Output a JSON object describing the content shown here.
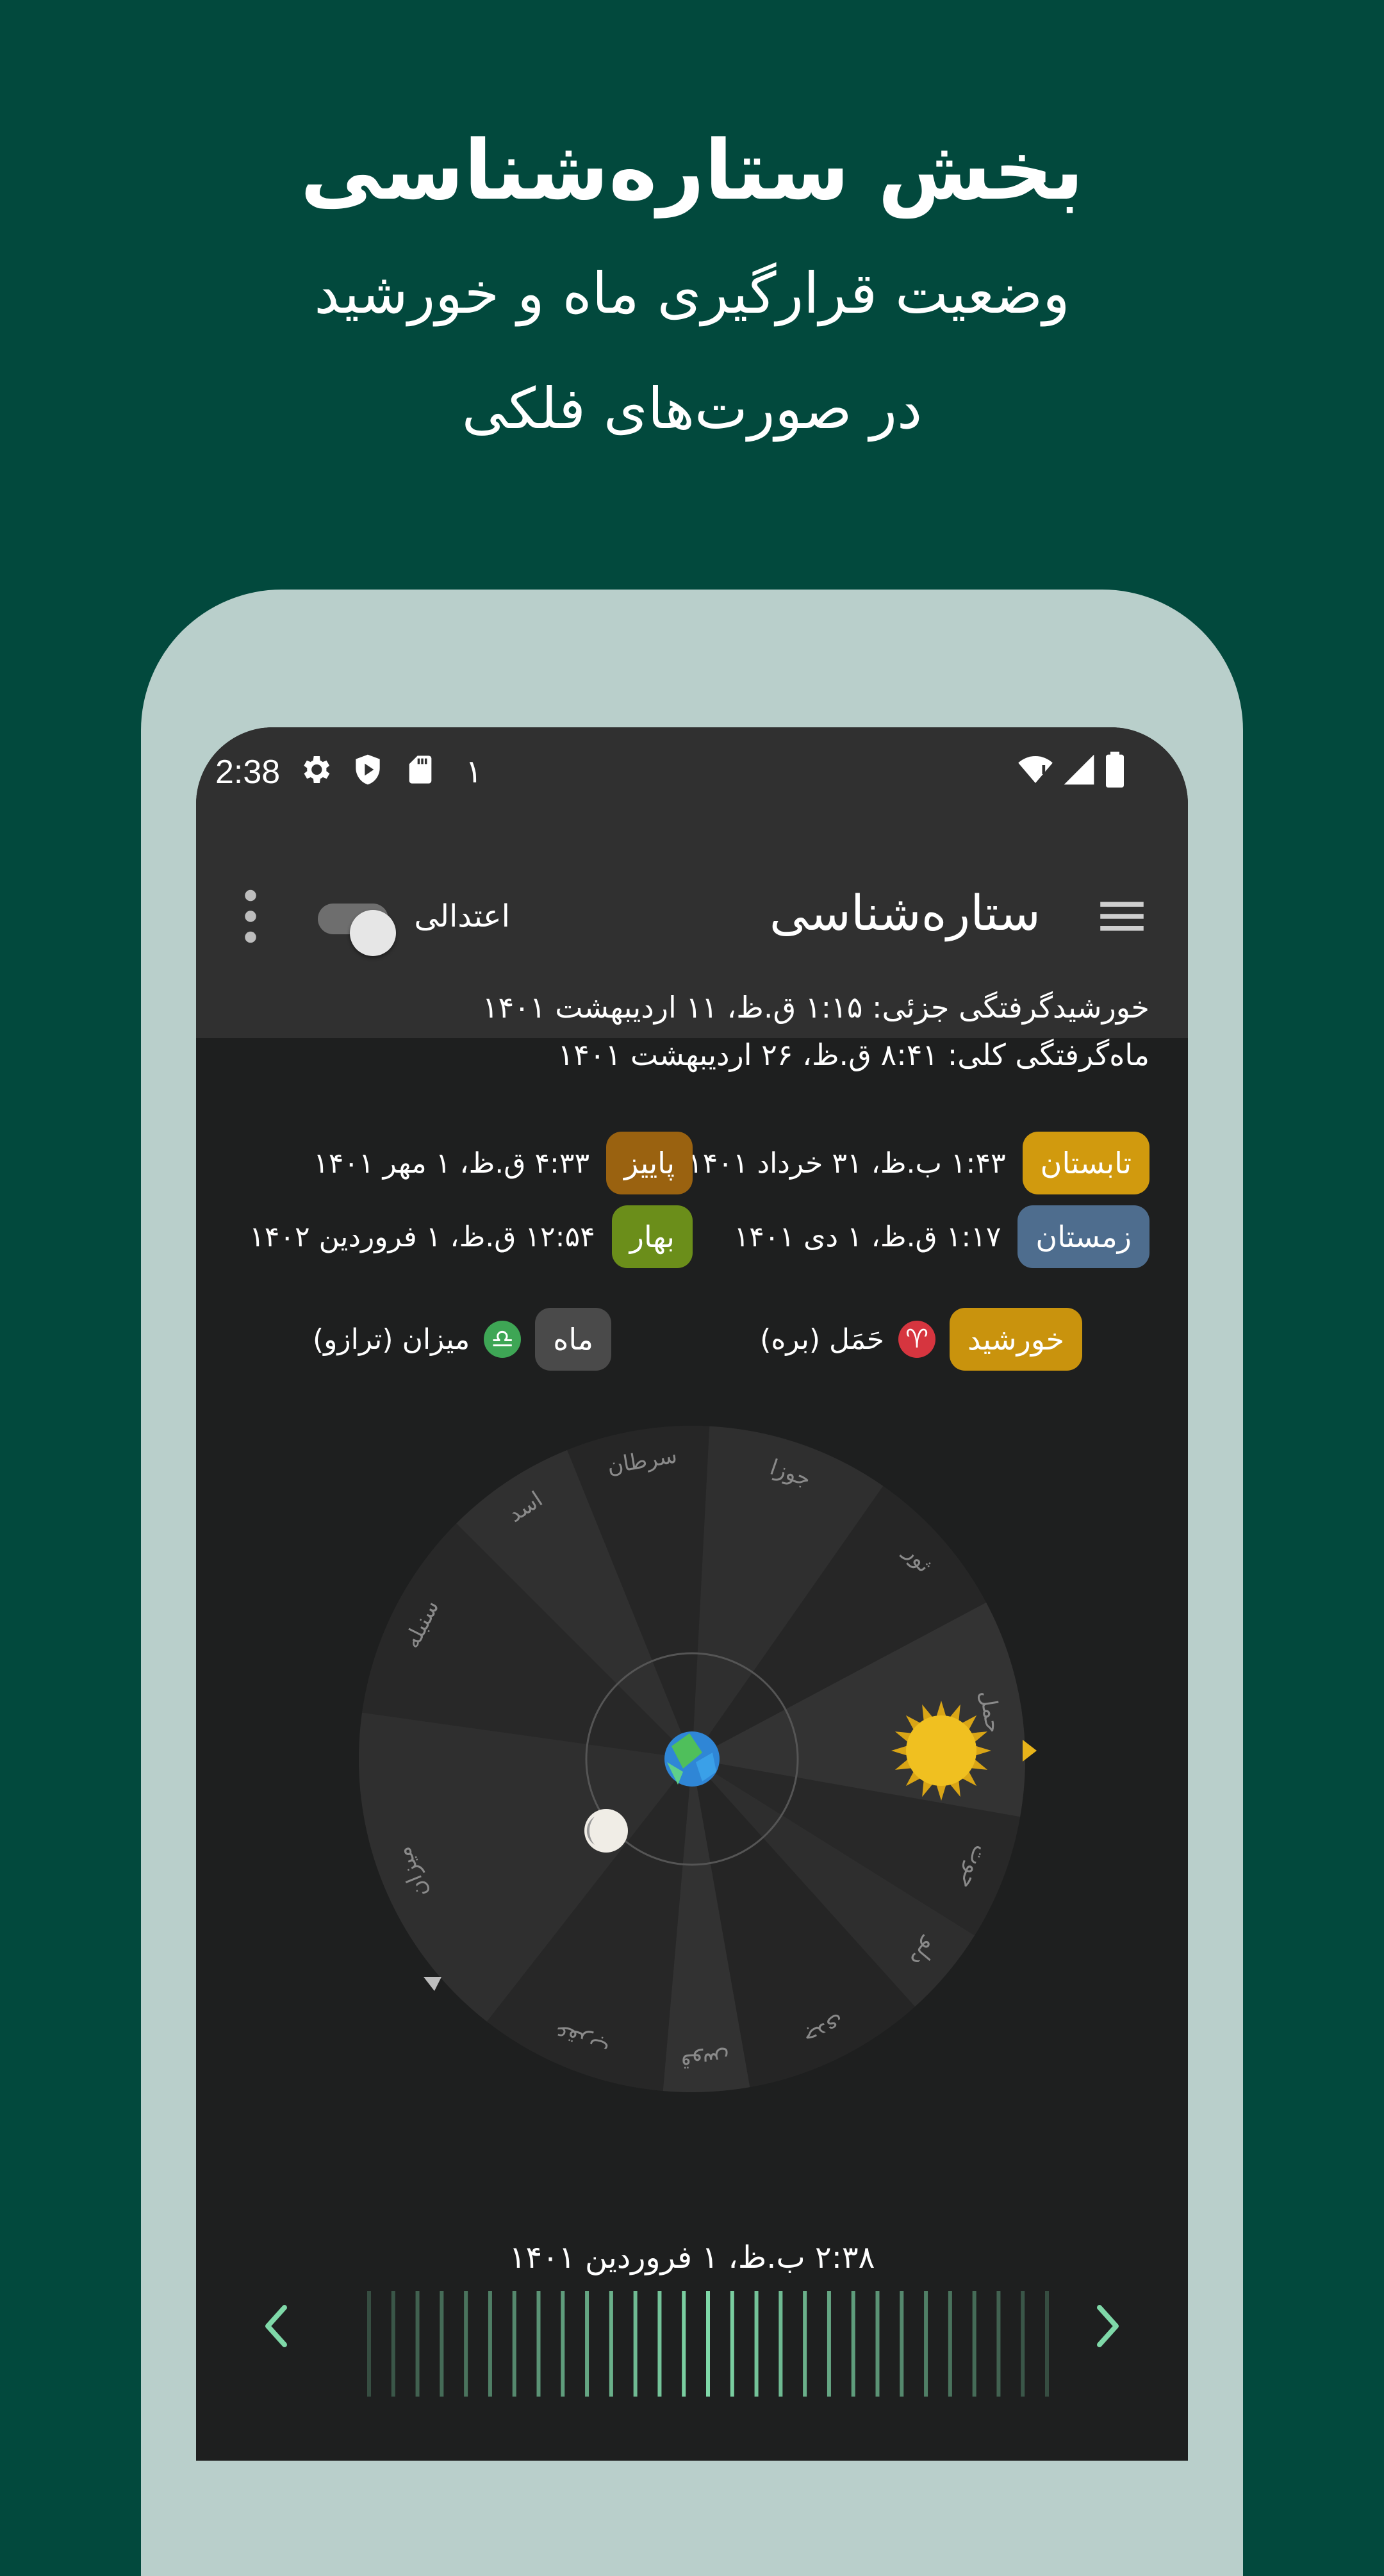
{
  "promo": {
    "title": "بخش ستاره‌شناسی",
    "subtitle_line1": "وضعیت قرارگیری ماه و خورشید",
    "subtitle_line2": "در صورت‌های فلکی"
  },
  "status_bar": {
    "time": "2:38",
    "notification_digit": "۱",
    "icons": [
      "gear-icon",
      "shield-play-icon",
      "sd-card-icon",
      "wifi-icon",
      "signal-icon",
      "battery-icon"
    ]
  },
  "app_bar": {
    "title": "ستاره‌شناسی",
    "toggle_label": "اعتدالی",
    "toggle_on": true,
    "menu_icon": "hamburger-menu-icon",
    "more_icon": "more-vert-icon"
  },
  "eclipses": {
    "solar": "خورشیدگرفتگی جزئی: ۱:۱۵ ق.ظ، ۱۱ اردیبهشت ۱۴۰۱",
    "lunar": "ماه‌گرفتگی کلی: ۸:۴۱ ق.ظ، ۲۶ اردیبهشت ۱۴۰۱"
  },
  "seasons": [
    {
      "name": "تابستان",
      "date": "۱:۴۳ ب.ظ، ۳۱ خرداد ۱۴۰۱",
      "color": "#d19a0e"
    },
    {
      "name": "پاییز",
      "date": "۴:۳۳ ق.ظ، ۱ مهر ۱۴۰۱",
      "color": "#9a6210"
    },
    {
      "name": "زمستان",
      "date": "۱:۱۷ ق.ظ، ۱ دی ۱۴۰۱",
      "color": "#4e6d8e"
    },
    {
      "name": "بهار",
      "date": "۱۲:۵۴ ق.ظ، ۱ فروردین ۱۴۰۲",
      "color": "#6b8e1a"
    }
  ],
  "positions": {
    "sun_label": "خورشید",
    "sun_sign": "حَمَل (بره)",
    "sun_glyph": "♈",
    "sun_color": "#c9930d",
    "moon_label": "ماه",
    "moon_sign": "میزان (ترازو)",
    "moon_glyph": "♎",
    "moon_color": "#4a4a4a"
  },
  "wheel": {
    "signs": [
      "جوزا",
      "ثور",
      "حمل",
      "حوت",
      "دلو",
      "جدی",
      "قوس",
      "عقرب",
      "میزان",
      "سنبله",
      "اسد",
      "سرطان"
    ]
  },
  "timeline": {
    "time_label": "۲:۳۸ ب.ظ، ۱ فروردین ۱۴۰۱",
    "prev_icon": "chevron-left-icon",
    "next_icon": "chevron-right-icon"
  },
  "colors": {
    "background": "#02493d",
    "phone_frame": "#b9cfcb",
    "screen_bg": "#1e1f1f",
    "bar_bg": "#303030",
    "accent": "#7fd8a8",
    "sun": "#f0c020"
  }
}
